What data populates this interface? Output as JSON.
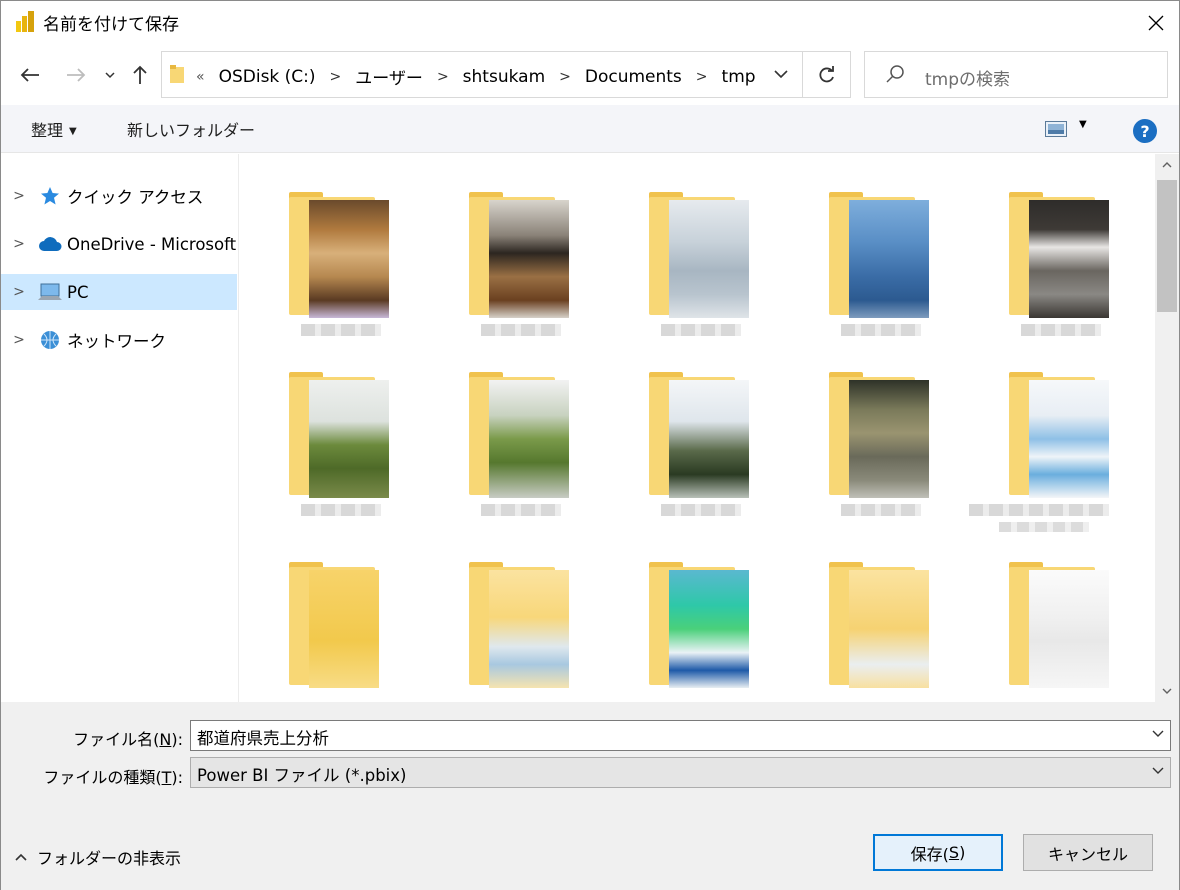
{
  "window": {
    "title": "名前を付けて保存"
  },
  "address": {
    "lead": "«",
    "crumbs": [
      "OSDisk (C:)",
      "ユーザー",
      "shtsukam",
      "Documents",
      "tmp"
    ],
    "search_placeholder": "tmpの検索"
  },
  "toolbar": {
    "organize": "整理",
    "new_folder": "新しいフォルダー"
  },
  "navpane": {
    "items": [
      {
        "label": "クイック アクセス",
        "icon": "star-icon"
      },
      {
        "label": "OneDrive - Microsoft",
        "icon": "cloud-icon"
      },
      {
        "label": "PC",
        "icon": "pc-icon",
        "selected": true
      },
      {
        "label": "ネットワーク",
        "icon": "network-icon"
      }
    ]
  },
  "form": {
    "filename_label": "ファイル名(",
    "filename_key": "N",
    "filename_label_end": "):",
    "filename_value": "都道府県売上分析",
    "filetype_label": "ファイルの種類(",
    "filetype_key": "T",
    "filetype_label_end": "):",
    "filetype_value": "Power BI ファイル (*.pbix)",
    "hide_folders": "フォルダーの非表示",
    "save_label": "保存(",
    "save_key": "S",
    "save_label_end": ")",
    "cancel_label": "キャンセル"
  },
  "colors": {
    "accent": "#0078d7",
    "selected": "#cce8ff",
    "folder": "#f8d775"
  }
}
